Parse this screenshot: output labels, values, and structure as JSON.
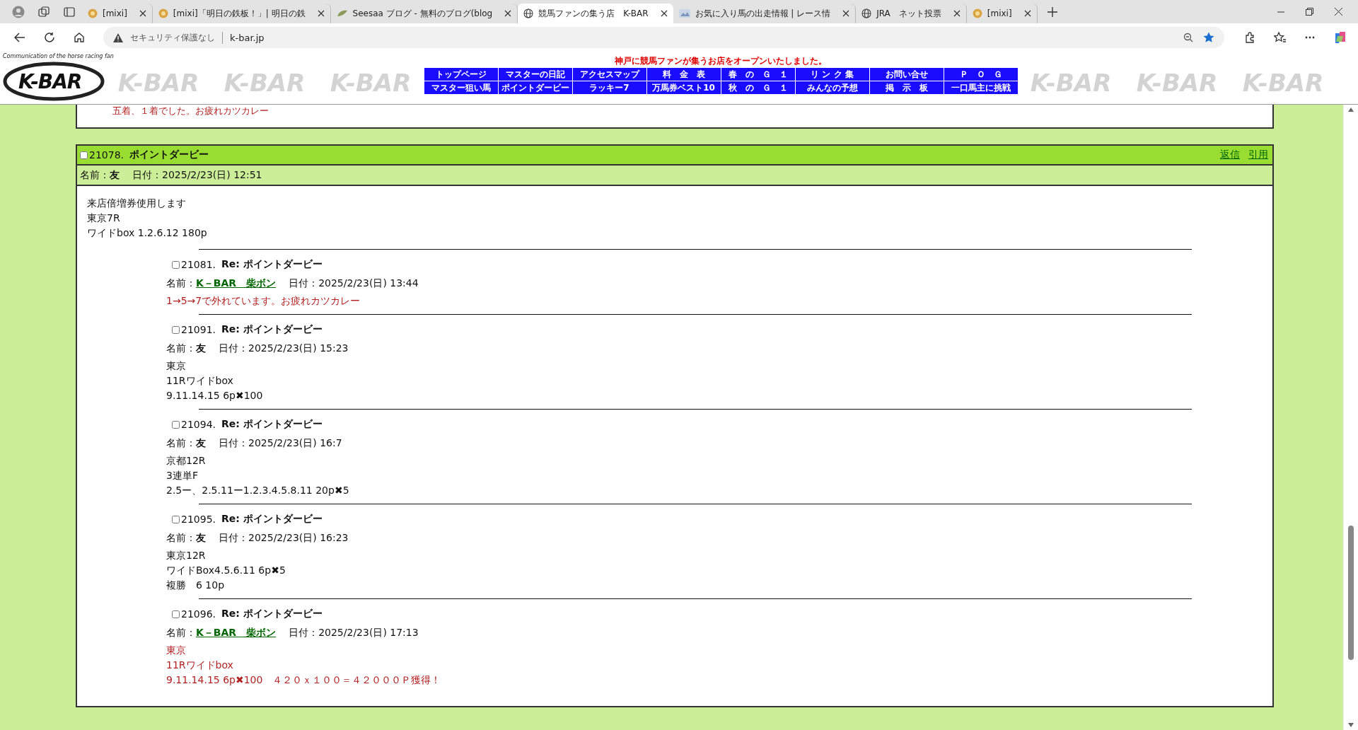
{
  "browser": {
    "tabs": [
      {
        "title": "[mixi]",
        "selected": false
      },
      {
        "title": "[mixi]「明日の鉄板！」| 明日の鉄",
        "selected": false
      },
      {
        "title": "Seesaa ブログ - 無料のブログ(blog",
        "selected": false
      },
      {
        "title": "競馬ファンの集う店　K-BAR",
        "selected": true
      },
      {
        "title": "お気に入り馬の出走情報 | レース情",
        "selected": false
      },
      {
        "title": "JRA　ネット投票",
        "selected": false
      },
      {
        "title": "[mixi]",
        "selected": false
      }
    ],
    "security": "セキュリティ保護なし",
    "url": "k-bar.jp"
  },
  "site": {
    "logo": "K-BAR",
    "logo_tagline": "Communication of the horse racing fan",
    "banner_marks": [
      "K-BAR",
      "K-BAR",
      "K-BAR",
      "K-BAR",
      "K-BAR",
      "K-BAR"
    ],
    "announcement": "神戸に競馬ファンが集うお店をオープンいたしました。",
    "nav": [
      [
        "トップページ",
        "マスターの日記",
        "アクセスマップ",
        "料　金　表",
        "春　の　Ｇ　１",
        "リ ン ク 集",
        "お問い合せ",
        "Ｐ　Ｏ　Ｇ"
      ],
      [
        "マスター狙い馬",
        "ポイントダービー",
        "ラッキー7",
        "万馬券ベスト10",
        "秋　の　Ｇ　１",
        "みんなの予想",
        "掲　示　板",
        "一口馬主に挑戦"
      ]
    ]
  },
  "previous_post_tail": "五着、１着でした。お疲れカツカレー",
  "post": {
    "checked": false,
    "number": "21078.",
    "title": "ポイントダービー",
    "actions": [
      "返信",
      "引用"
    ],
    "name_label": "名前：",
    "name": "友",
    "name_link": false,
    "date_label": "日付：",
    "date": "2025/2/23(日) 12:51",
    "body": [
      "来店倍増券使用します",
      "東京7R",
      "ワイドbox 1.2.6.12 180p"
    ],
    "replies": [
      {
        "checked": false,
        "number": "21081.",
        "title": "Re: ポイントダービー",
        "name_label": "名前：",
        "name": "K－BAR　柴ボン",
        "name_link": true,
        "date_label": "日付：",
        "date": "2025/2/23(日) 13:44",
        "highlighted": true,
        "body": [
          "1→5→7で外れています。お疲れカツカレー"
        ]
      },
      {
        "checked": false,
        "number": "21091.",
        "title": "Re: ポイントダービー",
        "name_label": "名前：",
        "name": "友",
        "name_link": false,
        "date_label": "日付：",
        "date": "2025/2/23(日) 15:23",
        "highlighted": false,
        "body": [
          "東京",
          "11Rワイドbox",
          "9.11.14.15 6p✖100"
        ]
      },
      {
        "checked": false,
        "number": "21094.",
        "title": "Re: ポイントダービー",
        "name_label": "名前：",
        "name": "友",
        "name_link": false,
        "date_label": "日付：",
        "date": "2025/2/23(日) 16:7",
        "highlighted": false,
        "body": [
          "京都12R",
          "3連単F",
          "2.5ー、2.5.11ー1.2.3.4.5.8.11 20p✖5"
        ]
      },
      {
        "checked": false,
        "number": "21095.",
        "title": "Re: ポイントダービー",
        "name_label": "名前：",
        "name": "友",
        "name_link": false,
        "date_label": "日付：",
        "date": "2025/2/23(日) 16:23",
        "highlighted": false,
        "body": [
          "東京12R",
          "ワイドBox4.5.6.11 6p✖5",
          "複勝　6 10p"
        ]
      },
      {
        "checked": false,
        "number": "21096.",
        "title": "Re: ポイントダービー",
        "name_label": "名前：",
        "name": "K－BAR　柴ボン",
        "name_link": true,
        "date_label": "日付：",
        "date": "2025/2/23(日) 17:13",
        "highlighted": true,
        "body": [
          "東京",
          "11Rワイドbox",
          "9.11.14.15 6p✖100　４２０ｘ１００＝４２０００Ｐ獲得！"
        ]
      }
    ]
  }
}
